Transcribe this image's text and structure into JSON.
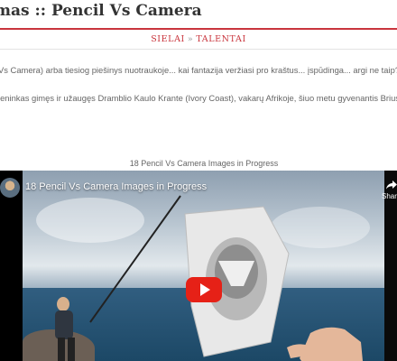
{
  "page": {
    "title": "mas :: Pencil Vs Camera",
    "categories": [
      {
        "label": "SIELAI"
      },
      {
        "label": "TALENTAI"
      }
    ],
    "category_separator": "»",
    "paragraphs": [
      "Vs Camera) arba tiesiog piešinys nuotraukoje... kai fantazija veržiasi pro kraštus... įspūdinga... argi ne taip? :)",
      "leninkas gimęs ir užaugęs Dramblio Kaulo Krante (Ivory Coast), vakarų Afrikoje, šiuo metu gyvenantis Briusely"
    ],
    "caption": "18 Pencil Vs Camera Images in Progress"
  },
  "video": {
    "title": "18 Pencil Vs Camera Images in Progress",
    "share_label": "Shar",
    "icons": {
      "channel_avatar": "avatar-icon",
      "share": "share-icon",
      "play": "youtube-play-icon"
    }
  },
  "colors": {
    "accent": "#c9353d",
    "play_button": "#e62117"
  }
}
